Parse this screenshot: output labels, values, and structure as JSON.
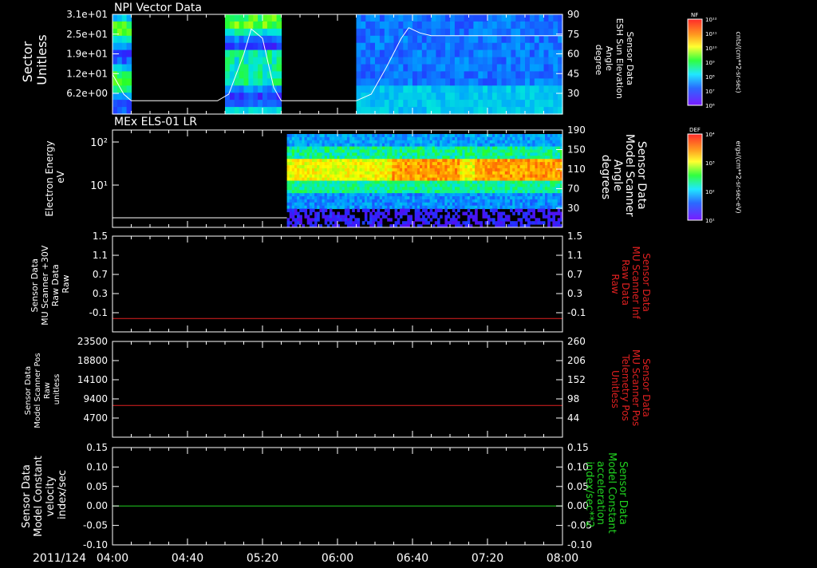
{
  "time_axis": {
    "start_label": "2011/124",
    "ticks": [
      "04:00",
      "04:40",
      "05:20",
      "06:00",
      "06:40",
      "07:20",
      "08:00"
    ]
  },
  "chart_data": [
    {
      "type": "heatmap",
      "title": "NPI Vector Data",
      "ylabel_left": [
        "Sector",
        "Unitless"
      ],
      "ylabel_right": [
        "Sensor Data",
        "ESH Sun Elevation",
        "Angle",
        "degree"
      ],
      "yticks_left": [
        "3.1e+01",
        "2.5e+01",
        "1.9e+01",
        "1.2e+01",
        "6.2e+00"
      ],
      "yticks_right": [
        "90",
        "75",
        "60",
        "45",
        "30"
      ],
      "ylim_right": [
        15,
        90
      ],
      "data_intervals": [
        [
          "04:00",
          "04:10"
        ],
        [
          "04:58",
          "05:30"
        ],
        [
          "06:10",
          "08:00"
        ]
      ],
      "overlay_line": {
        "name": "ESH Sun Elevation Angle",
        "color": "#ffffff",
        "x": [
          "04:00",
          "04:06",
          "04:10",
          "04:56",
          "05:02",
          "05:10",
          "05:14",
          "05:20",
          "05:26",
          "05:30",
          "06:10",
          "06:18",
          "06:26",
          "06:34",
          "06:38",
          "06:44",
          "06:50",
          "08:00"
        ],
        "y": [
          45,
          30,
          25,
          25,
          30,
          60,
          79,
          72,
          35,
          25,
          25,
          30,
          50,
          72,
          80,
          76,
          74,
          74
        ]
      },
      "colorbar": {
        "label": "NF",
        "unit": "cnts/(cm**2-sr-sec)",
        "ticks": [
          "10¹²",
          "10¹¹",
          "10¹⁰",
          "10⁹",
          "10⁸",
          "10⁷",
          "10⁶"
        ]
      }
    },
    {
      "type": "heatmap",
      "title": "MEx ELS-01 LR",
      "ylabel_left": [
        "Electron Energy",
        "eV"
      ],
      "ylabel_right": [
        "Sensor Data",
        "Model Scanner",
        "Angle",
        "degrees"
      ],
      "yticks_left": [
        "10²",
        "10¹"
      ],
      "yticks_right": [
        "190",
        "150",
        "110",
        "70",
        "30"
      ],
      "data_start": "05:33",
      "overlay_line": {
        "name": "Model Scanner Angle",
        "color": "#ffffff",
        "x": [
          "04:00",
          "05:33"
        ],
        "y": [
          15,
          15
        ]
      },
      "colorbar": {
        "label": "DEF",
        "unit": "ergs/(cm**2-sr-sec-eV)",
        "ticks": [
          "10⁴",
          "10³",
          "10²",
          "10¹"
        ]
      }
    },
    {
      "type": "line",
      "ylabel_left": [
        "Sensor Data",
        "MU Scanner +30V",
        "Raw Data",
        "Raw"
      ],
      "ylabel_right": [
        "Sensor Data",
        "MU Scanner Inf",
        "Raw Data",
        "Raw"
      ],
      "yticks_left": [
        "1.5",
        "1.1",
        "0.7",
        "0.3",
        "-0.1"
      ],
      "yticks_right": [
        "1.5",
        "1.1",
        "0.7",
        "0.3",
        "-0.1"
      ],
      "ylim": [
        -0.3,
        1.5
      ],
      "series": [
        {
          "color": "#e02020",
          "x": [
            "04:00",
            "08:00"
          ],
          "values": [
            -0.05,
            -0.05
          ]
        }
      ]
    },
    {
      "type": "line",
      "ylabel_left": [
        "Sensor Data",
        "Model Scanner Pos",
        "Raw",
        "unitless"
      ],
      "ylabel_right": [
        "Sensor Data",
        "MU Scanner Pos",
        "Telemetry Pos",
        "Unitless"
      ],
      "yticks_left": [
        "23500",
        "18800",
        "14100",
        "9400",
        "4700"
      ],
      "yticks_right": [
        "260",
        "206",
        "152",
        "98",
        "44"
      ],
      "ylim": [
        0,
        23500
      ],
      "series": [
        {
          "color": "#e02020",
          "x": [
            "04:00",
            "08:00"
          ],
          "values": [
            7800,
            7800
          ]
        }
      ]
    },
    {
      "type": "line",
      "ylabel_left": [
        "Sensor Data",
        "Model Constant",
        "velocity",
        "index/sec"
      ],
      "ylabel_right": [
        "Sensor Data",
        "Model Constant",
        "acceleration",
        "index/sec**2"
      ],
      "yticks_left": [
        "0.15",
        "0.10",
        "0.05",
        "0.00",
        "-0.05",
        "-0.10"
      ],
      "yticks_right": [
        "0.15",
        "0.10",
        "0.05",
        "0.00",
        "-0.05",
        "-0.10"
      ],
      "ylim": [
        -0.1,
        0.15
      ],
      "series": [
        {
          "color": "#20d020",
          "x": [
            "04:00",
            "08:00"
          ],
          "values": [
            0,
            0
          ]
        }
      ]
    }
  ]
}
